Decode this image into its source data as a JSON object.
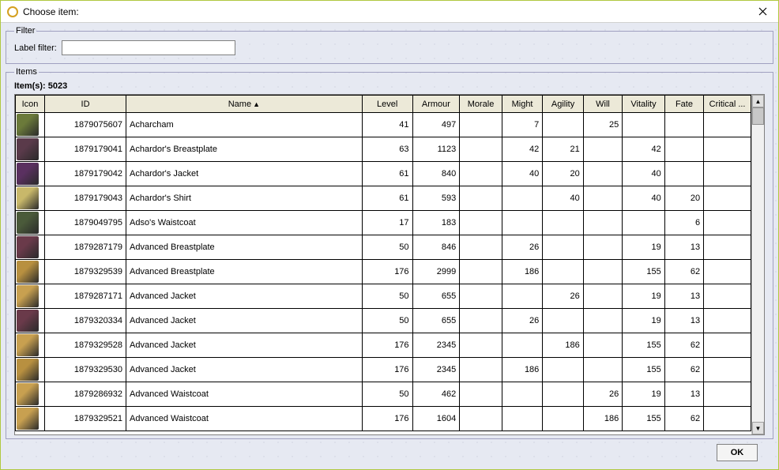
{
  "window": {
    "title": "Choose item:"
  },
  "filter": {
    "legend": "Filter",
    "label": "Label filter:",
    "value": ""
  },
  "items": {
    "legend": "Items",
    "count_label": "Item(s): 5023"
  },
  "columns": {
    "icon": "Icon",
    "id": "ID",
    "name": "Name",
    "level": "Level",
    "armour": "Armour",
    "morale": "Morale",
    "might": "Might",
    "agility": "Agility",
    "will": "Will",
    "vitality": "Vitality",
    "fate": "Fate",
    "critical": "Critical ..."
  },
  "sort": {
    "column": "name",
    "dir": "asc",
    "glyph": "▲"
  },
  "rows": [
    {
      "icon_color": "#6b7a3a",
      "id": "1879075607",
      "name": "Acharcham",
      "level": "41",
      "armour": "497",
      "morale": "",
      "might": "7",
      "agility": "",
      "will": "25",
      "vitality": "",
      "fate": "",
      "critical": ""
    },
    {
      "icon_color": "#5a3a4a",
      "id": "1879179041",
      "name": "Achardor's Breastplate",
      "level": "63",
      "armour": "1123",
      "morale": "",
      "might": "42",
      "agility": "21",
      "will": "",
      "vitality": "42",
      "fate": "",
      "critical": ""
    },
    {
      "icon_color": "#5a3060",
      "id": "1879179042",
      "name": "Achardor's Jacket",
      "level": "61",
      "armour": "840",
      "morale": "",
      "might": "40",
      "agility": "20",
      "will": "",
      "vitality": "40",
      "fate": "",
      "critical": ""
    },
    {
      "icon_color": "#c8b86a",
      "id": "1879179043",
      "name": "Achardor's Shirt",
      "level": "61",
      "armour": "593",
      "morale": "",
      "might": "",
      "agility": "40",
      "will": "",
      "vitality": "40",
      "fate": "20",
      "critical": ""
    },
    {
      "icon_color": "#4a5a3a",
      "id": "1879049795",
      "name": "Adso's Waistcoat",
      "level": "17",
      "armour": "183",
      "morale": "",
      "might": "",
      "agility": "",
      "will": "",
      "vitality": "",
      "fate": "6",
      "critical": ""
    },
    {
      "icon_color": "#6a3a4a",
      "id": "1879287179",
      "name": "Advanced Breastplate",
      "level": "50",
      "armour": "846",
      "morale": "",
      "might": "26",
      "agility": "",
      "will": "",
      "vitality": "19",
      "fate": "13",
      "critical": ""
    },
    {
      "icon_color": "#b89040",
      "id": "1879329539",
      "name": "Advanced Breastplate",
      "level": "176",
      "armour": "2999",
      "morale": "",
      "might": "186",
      "agility": "",
      "will": "",
      "vitality": "155",
      "fate": "62",
      "critical": ""
    },
    {
      "icon_color": "#c8a050",
      "id": "1879287171",
      "name": "Advanced Jacket",
      "level": "50",
      "armour": "655",
      "morale": "",
      "might": "",
      "agility": "26",
      "will": "",
      "vitality": "19",
      "fate": "13",
      "critical": ""
    },
    {
      "icon_color": "#6a3a4a",
      "id": "1879320334",
      "name": "Advanced Jacket",
      "level": "50",
      "armour": "655",
      "morale": "",
      "might": "26",
      "agility": "",
      "will": "",
      "vitality": "19",
      "fate": "13",
      "critical": ""
    },
    {
      "icon_color": "#c8a050",
      "id": "1879329528",
      "name": "Advanced Jacket",
      "level": "176",
      "armour": "2345",
      "morale": "",
      "might": "",
      "agility": "186",
      "will": "",
      "vitality": "155",
      "fate": "62",
      "critical": ""
    },
    {
      "icon_color": "#b89040",
      "id": "1879329530",
      "name": "Advanced Jacket",
      "level": "176",
      "armour": "2345",
      "morale": "",
      "might": "186",
      "agility": "",
      "will": "",
      "vitality": "155",
      "fate": "62",
      "critical": ""
    },
    {
      "icon_color": "#c8a050",
      "id": "1879286932",
      "name": "Advanced Waistcoat",
      "level": "50",
      "armour": "462",
      "morale": "",
      "might": "",
      "agility": "",
      "will": "26",
      "vitality": "19",
      "fate": "13",
      "critical": ""
    },
    {
      "icon_color": "#c8a050",
      "id": "1879329521",
      "name": "Advanced Waistcoat",
      "level": "176",
      "armour": "1604",
      "morale": "",
      "might": "",
      "agility": "",
      "will": "186",
      "vitality": "155",
      "fate": "62",
      "critical": ""
    }
  ],
  "buttons": {
    "ok": "OK"
  }
}
